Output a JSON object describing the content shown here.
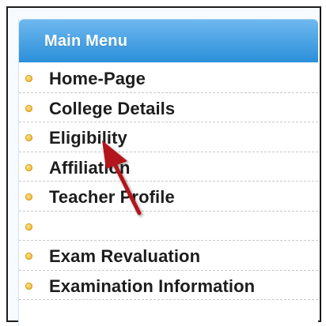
{
  "menu": {
    "title": "Main Menu",
    "items": [
      {
        "label": "Home-Page"
      },
      {
        "label": "College Details"
      },
      {
        "label": "Eligibility"
      },
      {
        "label": "Affiliation"
      },
      {
        "label": "Teacher Profile"
      },
      {
        "label": ""
      },
      {
        "label": "Exam Revaluation"
      },
      {
        "label": "Examination Information"
      }
    ]
  },
  "colors": {
    "header_top": "#6fb9ef",
    "header_bottom": "#2b8fd9",
    "bullet": "#e0a81e",
    "annotation_arrow": "#b2161b"
  },
  "icons": {
    "bullet": "yellow-dot-bullet-icon",
    "annotation": "red-arrow-icon"
  }
}
